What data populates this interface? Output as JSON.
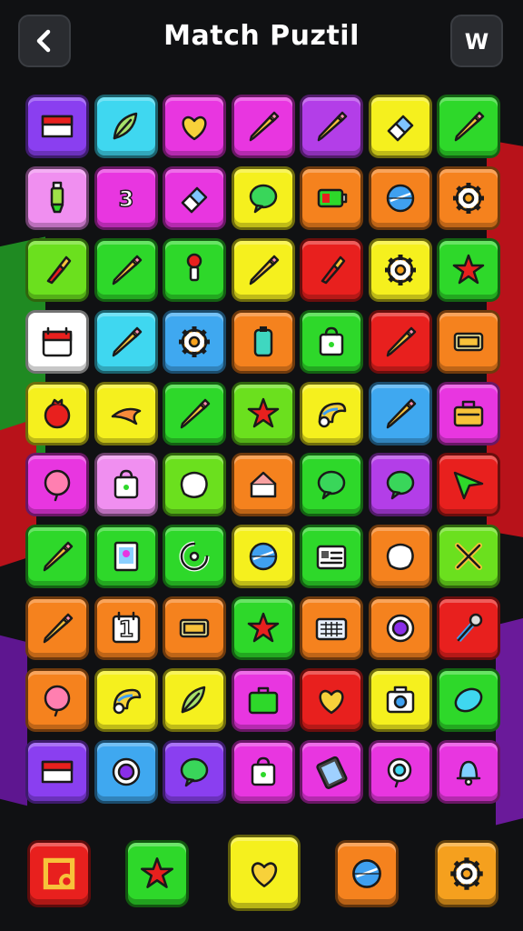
{
  "header": {
    "title": "Match Puztil",
    "back_icon": "chevron-left-icon",
    "menu_label": "W"
  },
  "colors": {
    "background": "#101113",
    "header_button": "#2a2c30"
  },
  "board": {
    "rows": 10,
    "columns": 7,
    "tiles": [
      [
        {
          "color": "#8a3ff0",
          "icon": "flag"
        },
        {
          "color": "#3fd7f0",
          "icon": "leaf"
        },
        {
          "color": "#e836e0",
          "icon": "heart"
        },
        {
          "color": "#e836e0",
          "icon": "pencil"
        },
        {
          "color": "#b33ee8",
          "icon": "pencil"
        },
        {
          "color": "#f5f01e",
          "icon": "eraser"
        },
        {
          "color": "#2ed82a",
          "icon": "pencil"
        }
      ],
      [
        {
          "color": "#f08ff0",
          "icon": "marker"
        },
        {
          "color": "#e836e0",
          "icon": "number",
          "text": "3"
        },
        {
          "color": "#e836e0",
          "icon": "eraser"
        },
        {
          "color": "#f5f01e",
          "icon": "speech-bubble"
        },
        {
          "color": "#f5821e",
          "icon": "battery"
        },
        {
          "color": "#f5821e",
          "icon": "globe"
        },
        {
          "color": "#f5821e",
          "icon": "gear"
        }
      ],
      [
        {
          "color": "#6be01e",
          "icon": "brush"
        },
        {
          "color": "#2ed82a",
          "icon": "pencil"
        },
        {
          "color": "#2ed82a",
          "icon": "pin"
        },
        {
          "color": "#f5f01e",
          "icon": "pencil"
        },
        {
          "color": "#e8201e",
          "icon": "brush"
        },
        {
          "color": "#f5f01e",
          "icon": "gear"
        },
        {
          "color": "#2ed82a",
          "icon": "star"
        }
      ],
      [
        {
          "color": "#ffffff",
          "icon": "calendar"
        },
        {
          "color": "#3fd7f0",
          "icon": "pencil"
        },
        {
          "color": "#3fa8f0",
          "icon": "gear"
        },
        {
          "color": "#f5821e",
          "icon": "clipboard"
        },
        {
          "color": "#2ed82a",
          "icon": "bag"
        },
        {
          "color": "#e8201e",
          "icon": "pencil"
        },
        {
          "color": "#f5821e",
          "icon": "card"
        }
      ],
      [
        {
          "color": "#f5f01e",
          "icon": "ball"
        },
        {
          "color": "#f5f01e",
          "icon": "bird"
        },
        {
          "color": "#2ed82a",
          "icon": "pencil"
        },
        {
          "color": "#6be01e",
          "icon": "star"
        },
        {
          "color": "#f5f01e",
          "icon": "shell"
        },
        {
          "color": "#3fa8f0",
          "icon": "pencil"
        },
        {
          "color": "#e836e0",
          "icon": "toolbox"
        }
      ],
      [
        {
          "color": "#e836e0",
          "icon": "balloon"
        },
        {
          "color": "#f08ff0",
          "icon": "bag"
        },
        {
          "color": "#6be01e",
          "icon": "blob"
        },
        {
          "color": "#f5821e",
          "icon": "cake"
        },
        {
          "color": "#2ed82a",
          "icon": "speech-bubble"
        },
        {
          "color": "#b33ee8",
          "icon": "speech-bubble"
        },
        {
          "color": "#e8201e",
          "icon": "arrow"
        }
      ],
      [
        {
          "color": "#2ed82a",
          "icon": "pencil"
        },
        {
          "color": "#2ed82a",
          "icon": "picture"
        },
        {
          "color": "#2ed82a",
          "icon": "swirl"
        },
        {
          "color": "#f5f01e",
          "icon": "globe"
        },
        {
          "color": "#2ed82a",
          "icon": "id-card"
        },
        {
          "color": "#f5821e",
          "icon": "blob"
        },
        {
          "color": "#6be01e",
          "icon": "cross"
        }
      ],
      [
        {
          "color": "#f5821e",
          "icon": "pencil"
        },
        {
          "color": "#f5821e",
          "icon": "calendar-number",
          "text": "1"
        },
        {
          "color": "#f5821e",
          "icon": "card"
        },
        {
          "color": "#2ed82a",
          "icon": "star"
        },
        {
          "color": "#f5821e",
          "icon": "keyboard"
        },
        {
          "color": "#f5821e",
          "icon": "ring"
        },
        {
          "color": "#e8201e",
          "icon": "tool"
        }
      ],
      [
        {
          "color": "#f5821e",
          "icon": "balloon"
        },
        {
          "color": "#f5f01e",
          "icon": "shell"
        },
        {
          "color": "#f5f01e",
          "icon": "leaf"
        },
        {
          "color": "#e836e0",
          "icon": "briefcase"
        },
        {
          "color": "#e8201e",
          "icon": "heart"
        },
        {
          "color": "#f5f01e",
          "icon": "camera"
        },
        {
          "color": "#2ed82a",
          "icon": "oval"
        }
      ],
      [
        {
          "color": "#8a3ff0",
          "icon": "flag"
        },
        {
          "color": "#3fa8f0",
          "icon": "ring"
        },
        {
          "color": "#8a3ff0",
          "icon": "speech-bubble"
        },
        {
          "color": "#e836e0",
          "icon": "bag"
        },
        {
          "color": "#e836e0",
          "icon": "tablet"
        },
        {
          "color": "#e836e0",
          "icon": "search"
        },
        {
          "color": "#e836e0",
          "icon": "bell"
        }
      ]
    ]
  },
  "toolbar": {
    "buttons": [
      {
        "name": "frame-tool-button",
        "color": "#e8201e",
        "icon": "frame"
      },
      {
        "name": "star-tool-button",
        "color": "#2ed82a",
        "icon": "star"
      },
      {
        "name": "heart-tool-button",
        "color": "#f5f01e",
        "icon": "heart"
      },
      {
        "name": "compass-tool-button",
        "color": "#f5821e",
        "icon": "globe"
      },
      {
        "name": "settings-button",
        "color": "#f5a01e",
        "icon": "gear"
      }
    ]
  }
}
